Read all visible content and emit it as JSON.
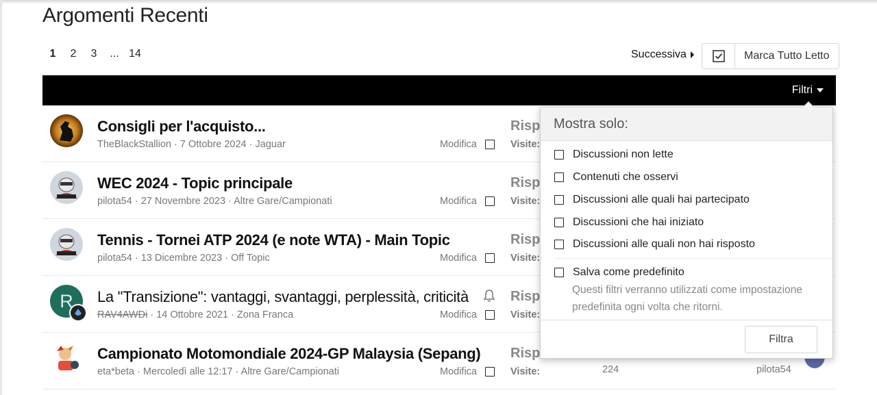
{
  "page": {
    "title": "Argomenti Recenti"
  },
  "pagination": {
    "pages": [
      "1",
      "2",
      "3",
      "...",
      "14"
    ],
    "current": "1"
  },
  "toolbar": {
    "next_label": "Successiva",
    "mark_all_label": "Marca Tutto Letto"
  },
  "header_bar": {
    "filter_label": "Filtri"
  },
  "topics": [
    {
      "title": "Consigli per l'acquisto...",
      "author": "TheBlackStallion",
      "date": "7 Ottobre 2024",
      "forum": "Jaguar",
      "edit": "Modifica",
      "stat1": "Rispo",
      "stat2": "Visite:"
    },
    {
      "title": "WEC 2024 - Topic principale",
      "author": "pilota54",
      "date": "27 Novembre 2023",
      "forum": "Altre Gare/Campionati",
      "edit": "Modifica",
      "stat1": "Rispo",
      "stat2": "Visite:"
    },
    {
      "title": "Tennis - Tornei ATP 2024 (e note WTA) - Main Topic",
      "author": "pilota54",
      "date": "13 Dicembre 2023",
      "forum": "Off Topic",
      "edit": "Modifica",
      "stat1": "Rispo",
      "stat2": "Visite:"
    },
    {
      "title": "La \"Transizione\": vantaggi, svantaggi, perplessità, criticità",
      "author": "RAV4AWDi",
      "date": "14 Ottobre 2021",
      "forum": "Zona Franca",
      "edit": "Modifica",
      "stat1": "Rispo",
      "stat2": "Visite:",
      "avatar_letter": "R"
    },
    {
      "title": "Campionato Motomondiale 2024-GP Malaysia (Sepang)",
      "author": "eta*beta",
      "date": "Mercoledì alle 12:17",
      "forum": "Altre Gare/Campionati",
      "edit": "Modifica",
      "stat1": "Rispo",
      "stat2": "Visite:",
      "views": "224",
      "last_user": "pilota54"
    }
  ],
  "filter_menu": {
    "heading": "Mostra solo:",
    "options": [
      "Discussioni non lette",
      "Contenuti che osservi",
      "Discussioni alle quali hai partecipato",
      "Discussioni che hai iniziato",
      "Discussioni alle quali non hai risposto"
    ],
    "save_default": "Salva come predefinito",
    "hint": "Questi filtri verranno utilizzati come impostazione predefinita ogni volta che ritorni.",
    "submit": "Filtra"
  },
  "colors": {
    "bar": "#000000",
    "avatar_green": "#1f6e5b"
  }
}
